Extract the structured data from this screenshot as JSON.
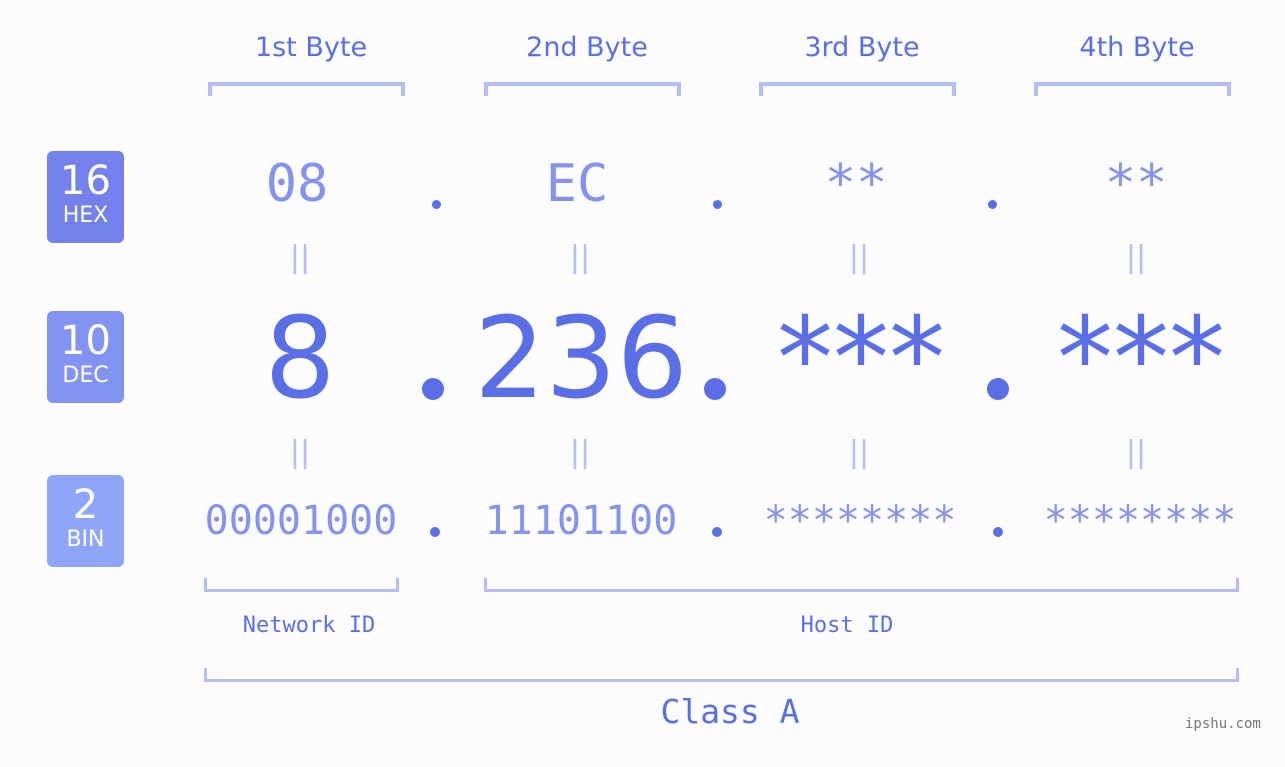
{
  "bytes": {
    "headers": [
      "1st Byte",
      "2nd Byte",
      "3rd Byte",
      "4th Byte"
    ]
  },
  "badges": {
    "hex": {
      "num": "16",
      "label": "HEX",
      "color": "#7481ec"
    },
    "dec": {
      "num": "10",
      "label": "DEC",
      "color": "#8393f2"
    },
    "bin": {
      "num": "2",
      "label": "BIN",
      "color": "#8fa6f8"
    }
  },
  "hex_values": [
    "08",
    "EC",
    "**",
    "**"
  ],
  "dec_values": [
    "8",
    "236",
    "***",
    "***"
  ],
  "bin_values": [
    "00001000",
    "11101100",
    "********",
    "********"
  ],
  "equals_symbol": "||",
  "segments": {
    "network_id": "Network ID",
    "host_id": "Host ID",
    "class": "Class A"
  },
  "watermark": "ipshu.com",
  "colors": {
    "accent": "#5a6fe6",
    "light_accent": "#8592ee",
    "bracket": "#b4bdf6",
    "background": "#fbfcfb"
  }
}
